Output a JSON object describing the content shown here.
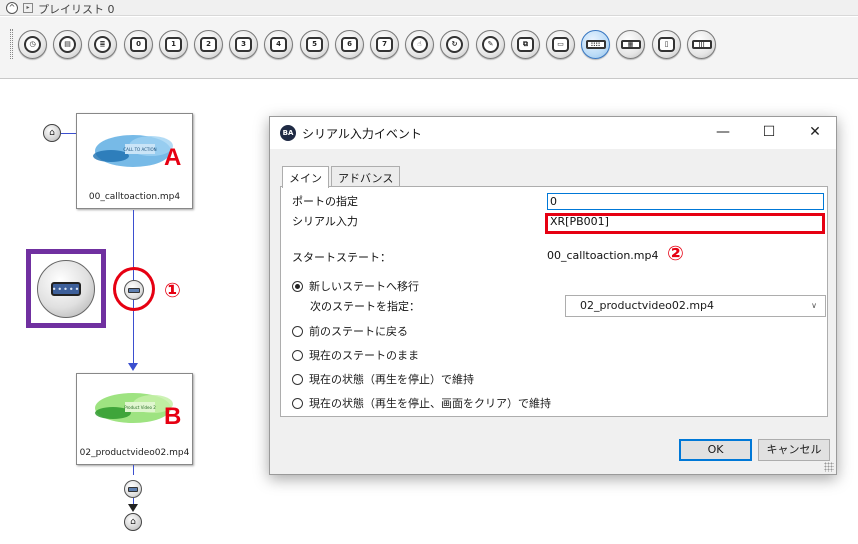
{
  "panel": {
    "title": "プレイリスト 0",
    "collapse_glyph": "^",
    "playlist_glyph": "▸"
  },
  "toolbar": {
    "buttons": [
      {
        "icon": "timer-icon",
        "glyph": "◷"
      },
      {
        "icon": "clapper-icon",
        "glyph": "▤"
      },
      {
        "icon": "list-icon",
        "glyph": "≣"
      },
      {
        "icon": "key-0-icon",
        "glyph": "0"
      },
      {
        "icon": "key-1-icon",
        "glyph": "1"
      },
      {
        "icon": "key-2-icon",
        "glyph": "2"
      },
      {
        "icon": "key-3-icon",
        "glyph": "3"
      },
      {
        "icon": "key-4-icon",
        "glyph": "4"
      },
      {
        "icon": "key-5-icon",
        "glyph": "5"
      },
      {
        "icon": "key-6-icon",
        "glyph": "6"
      },
      {
        "icon": "key-7-icon",
        "glyph": "7"
      },
      {
        "icon": "touch-icon",
        "glyph": "☝"
      },
      {
        "icon": "loop-icon",
        "glyph": "↻"
      },
      {
        "icon": "eraser-icon",
        "glyph": "✎"
      },
      {
        "icon": "window-icon",
        "glyph": "⧉"
      },
      {
        "icon": "monitor-icon",
        "glyph": "▭"
      },
      {
        "icon": "serial-icon",
        "glyph": "::::",
        "active": true
      },
      {
        "icon": "keyboard-icon",
        "glyph": "▦"
      },
      {
        "icon": "remote-icon",
        "glyph": "▯"
      },
      {
        "icon": "barcode-icon",
        "glyph": "|||"
      }
    ]
  },
  "canvas": {
    "home_glyph": "⌂",
    "state_a": {
      "filename": "00_calltoaction.mp4",
      "letter": "A",
      "thumb_text": "CALL TO ACTION"
    },
    "state_b": {
      "filename": "02_productvideo02.mp4",
      "letter": "B",
      "thumb_text": "Product Video 2"
    },
    "serial_port_glyph": "•••••",
    "annotation_1": "①",
    "annotation_2": "②"
  },
  "dialog": {
    "title": "シリアル入力イベント",
    "app_icon_text": "BA",
    "minimize": "—",
    "maximize": "☐",
    "close": "✕",
    "tabs": [
      {
        "label": "メイン",
        "active": true
      },
      {
        "label": "アドバンス",
        "active": false
      }
    ],
    "port_label": "ポートの指定",
    "port_value": "0",
    "serial_label": "シリアル入力",
    "serial_value": "XR[PB001]",
    "start_state_label": "スタートステート：",
    "start_state_value": "00_calltoaction.mp4",
    "options": [
      {
        "label": "新しいステートへ移行",
        "checked": true
      },
      {
        "label": "前のステートに戻る",
        "checked": false
      },
      {
        "label": "現在のステートのまま",
        "checked": false
      },
      {
        "label": "現在の状態（再生を停止）で維持",
        "checked": false
      },
      {
        "label": "現在の状態（再生を停止、画面をクリア）で維持",
        "checked": false
      }
    ],
    "next_state_label": "次のステートを指定：",
    "next_state_value": "02_productvideo02.mp4",
    "ok_label": "OK",
    "cancel_label": "キャンセル"
  },
  "colors": {
    "annotation_red": "#e60012",
    "frame_purple": "#7030a0",
    "connector_blue": "#3b4fcf",
    "focus_blue": "#0078d7"
  }
}
